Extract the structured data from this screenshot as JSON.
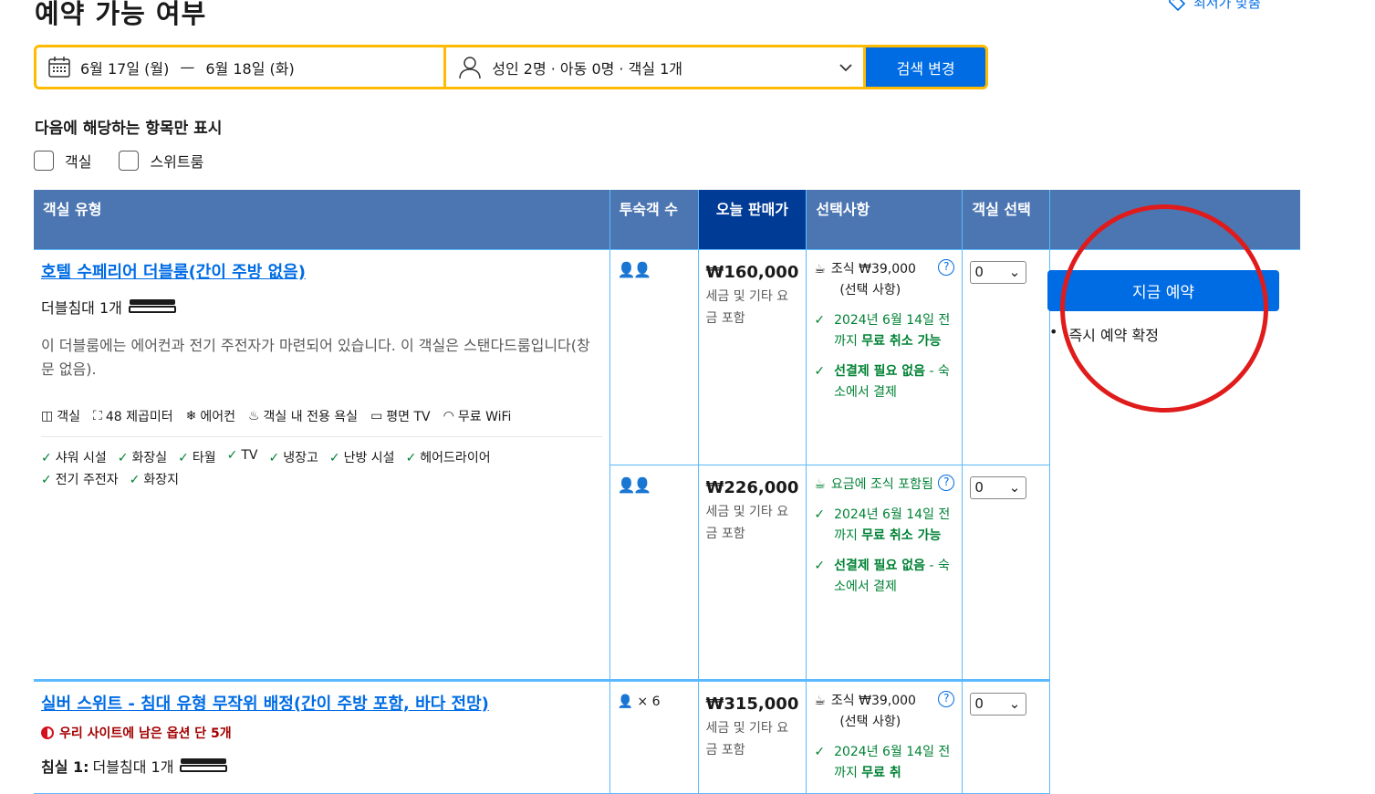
{
  "page_title": "예약 가능 여부",
  "best_price_link": "최저가 맞춤",
  "search": {
    "date_start": "6월 17일 (월)",
    "date_sep": "—",
    "date_end": "6월 18일 (화)",
    "guests": "성인 2명 · 아동 0명 · 객실 1개",
    "button": "검색 변경"
  },
  "filters": {
    "title": "다음에 해당하는 항목만 표시",
    "options": [
      "객실",
      "스위트룸"
    ]
  },
  "table_headers": [
    "객실 유형",
    "투숙객 수",
    "오늘 판매가",
    "선택사항",
    "객실 선택"
  ],
  "room1": {
    "name": "호텔 수페리어 더블룸(간이 주방 없음)",
    "bed": "더블침대 1개",
    "description": "이 더블룸에는 에어컨과 전기 주전자가 마련되어 있습니다. 이 객실은 스탠다드룸입니다(창문 없음).",
    "facilities": [
      "객실",
      "48 제곱미터",
      "에어컨",
      "객실 내 전용 욕실",
      "평면 TV",
      "무료 WiFi"
    ],
    "amenities": [
      "샤워 시설",
      "화장실",
      "타월",
      "TV",
      "냉장고",
      "난방 시설",
      "헤어드라이어",
      "전기 주전자",
      "화장지"
    ]
  },
  "offer1": {
    "price": "₩160,000",
    "tax_note": "세금 및 기타 요금 포함",
    "breakfast": "조식 ₩39,000",
    "breakfast_note": "(선택 사항)",
    "cancel_pre": "2024년 6월 14일 전까지 ",
    "cancel_bold": "무료 취소 가능",
    "prepay_bold": "선결제 필요 없음",
    "prepay_rest": " - 숙소에서 결제",
    "qty": "0"
  },
  "offer2": {
    "price": "₩226,000",
    "tax_note": "세금 및 기타 요금 포함",
    "breakfast": "요금에 조식 포함됨",
    "cancel_pre": "2024년 6월 14일 전까지 ",
    "cancel_bold": "무료 취소 가능",
    "prepay_bold": "선결제 필요 없음",
    "prepay_rest": " - 숙소에서 결제",
    "qty": "0"
  },
  "room2": {
    "name": "실버 스위트 - 침대 유형 무작위 배정(간이 주방 포함, 바다 전망)",
    "scarcity": "우리 사이트에 남은 옵션 단 5개",
    "bed_label": "침실 1:",
    "bed": "더블침대 1개",
    "guests": "× 6"
  },
  "offer3": {
    "price": "₩315,000",
    "tax_note": "세금 및 기타 요금 포함",
    "breakfast": "조식 ₩39,000",
    "breakfast_note": "(선택 사항)",
    "cancel_pre": "2024년 6월 14일 전까지 ",
    "cancel_bold": "무료 취",
    "qty": "0"
  },
  "reserve": {
    "button": "지금 예약",
    "note": "즉시 예약 확정"
  }
}
